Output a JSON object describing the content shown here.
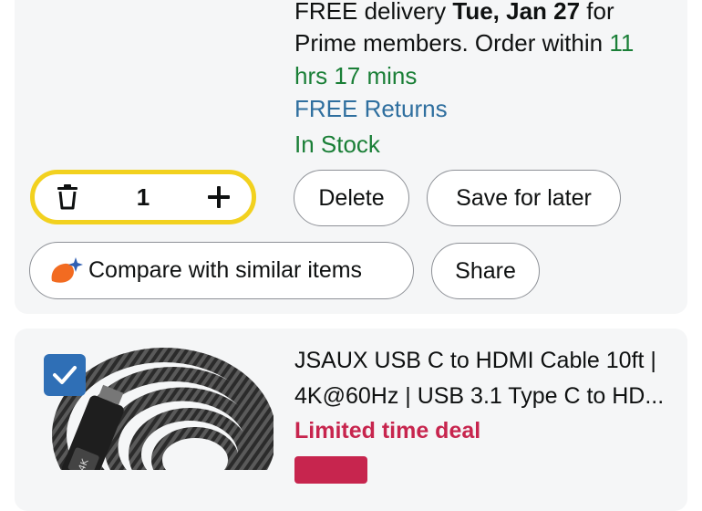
{
  "cart_item_1": {
    "delivery_prefix": "FREE delivery ",
    "delivery_date": "Tue, Jan 27",
    "delivery_suffix": " for",
    "prime_text": "Prime members. Order within ",
    "countdown_a": "11",
    "countdown_b": "hrs 17 mins",
    "returns": "FREE Returns",
    "stock": "In Stock",
    "quantity": "1",
    "delete_label": "Delete",
    "save_label": "Save for later",
    "compare_label": "Compare with similar items",
    "share_label": "Share"
  },
  "cart_item_2": {
    "title_line1": "JSAUX USB C to HDMI Cable 10ft |",
    "title_line2": "4K@60Hz | USB 3.1 Type C to HD...",
    "deal_label": "Limited time deal",
    "checked": true
  },
  "colors": {
    "stepper_border": "#f2d11f",
    "in_stock": "#1a7f37",
    "returns_link": "#2f6f9f",
    "deal": "#c7254e",
    "checkbox": "#2f6fb6"
  },
  "icons": {
    "trash": "trash-icon",
    "plus": "plus-icon",
    "compare": "sparkle-compare-icon",
    "check": "checkmark-icon"
  }
}
